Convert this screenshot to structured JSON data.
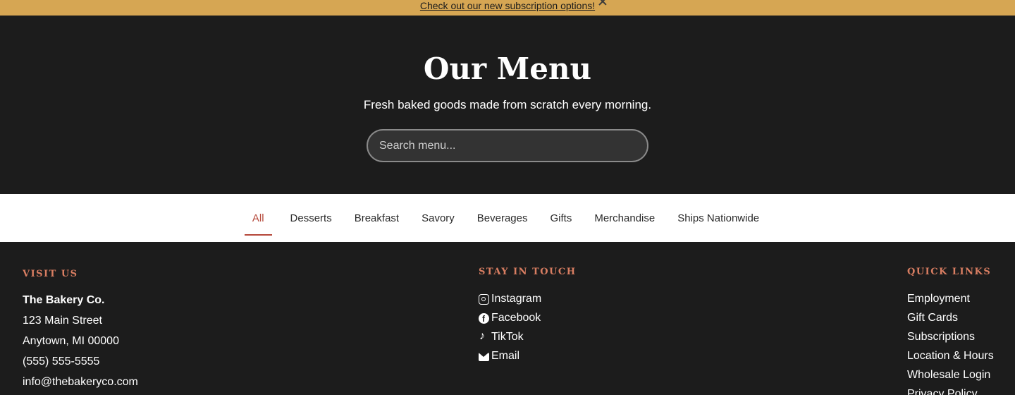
{
  "announcement": {
    "link_text": "Check out our new subscription options!",
    "close_icon": "close-icon"
  },
  "hero": {
    "title": "Our Menu",
    "subtitle": "Fresh baked goods made from scratch every morning.",
    "search_placeholder": "Search menu..."
  },
  "tabs": [
    {
      "label": "All",
      "active": true
    },
    {
      "label": "Desserts"
    },
    {
      "label": "Breakfast"
    },
    {
      "label": "Savory"
    },
    {
      "label": "Beverages"
    },
    {
      "label": "Gifts"
    },
    {
      "label": "Merchandise"
    },
    {
      "label": "Ships Nationwide"
    }
  ],
  "footer": {
    "visit": {
      "heading": "VISIT US",
      "name": "The Bakery Co.",
      "street": "123 Main Street",
      "city": "Anytown, MI 00000",
      "phone": "(555) 555-5555",
      "email": "info@thebakeryco.com"
    },
    "touch": {
      "heading": "STAY IN TOUCH",
      "items": [
        {
          "label": "Instagram",
          "icon": "instagram-icon"
        },
        {
          "label": "Facebook",
          "icon": "facebook-icon"
        },
        {
          "label": "TikTok",
          "icon": "tiktok-icon"
        },
        {
          "label": "Email",
          "icon": "mail-icon"
        }
      ]
    },
    "quick": {
      "heading": "QUICK LINKS",
      "items": [
        "Employment",
        "Gift Cards",
        "Subscriptions",
        "Location & Hours",
        "Wholesale Login",
        "Privacy Policy"
      ]
    }
  },
  "colors": {
    "announce_bg": "#d6a653",
    "dark_bg": "#1c1c1c",
    "accent": "#b5483a",
    "heading_accent": "#d97e62"
  }
}
